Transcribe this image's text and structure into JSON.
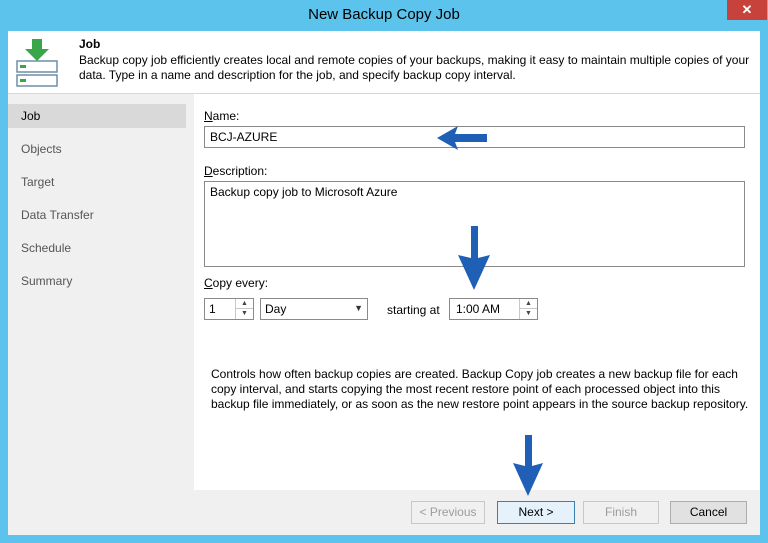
{
  "window": {
    "title": "New Backup Copy Job",
    "close_glyph": "✕"
  },
  "header": {
    "title": "Job",
    "description": "Backup copy job efficiently creates local and remote copies of your backups, making it easy to maintain multiple copies of your data. Type in a name and description for the job, and specify backup copy interval.",
    "icon": "backup-copy-job-icon"
  },
  "sidebar": {
    "items": [
      {
        "label": "Job",
        "active": true
      },
      {
        "label": "Objects"
      },
      {
        "label": "Target"
      },
      {
        "label": "Data Transfer"
      },
      {
        "label": "Schedule"
      },
      {
        "label": "Summary"
      }
    ]
  },
  "form": {
    "name_label_accel": "N",
    "name_label_rest": "ame:",
    "name_value": "BCJ-AZURE",
    "description_label_accel": "D",
    "description_label_rest": "escription:",
    "description_value": "Backup copy job to Microsoft Azure",
    "copy_every_label_accel": "C",
    "copy_every_label_rest": "opy every:",
    "copy_every_value": "1",
    "interval_unit": "Day",
    "starting_at_label": "starting at",
    "starting_at_value": "1:00 AM",
    "info_text": "Controls how often backup copies are created. Backup Copy job creates a new backup file for each copy interval, and starts copying the most recent restore point of each processed object into this backup file immediately, or as soon as the new restore point appears in the source backup repository."
  },
  "footer": {
    "previous_label": "< Previous",
    "next_label": "Next >",
    "finish_label": "Finish",
    "cancel_label": "Cancel"
  },
  "colors": {
    "frame": "#5bc3ec",
    "annotation_arrow": "#1f5fb6",
    "close": "#c7423b"
  }
}
